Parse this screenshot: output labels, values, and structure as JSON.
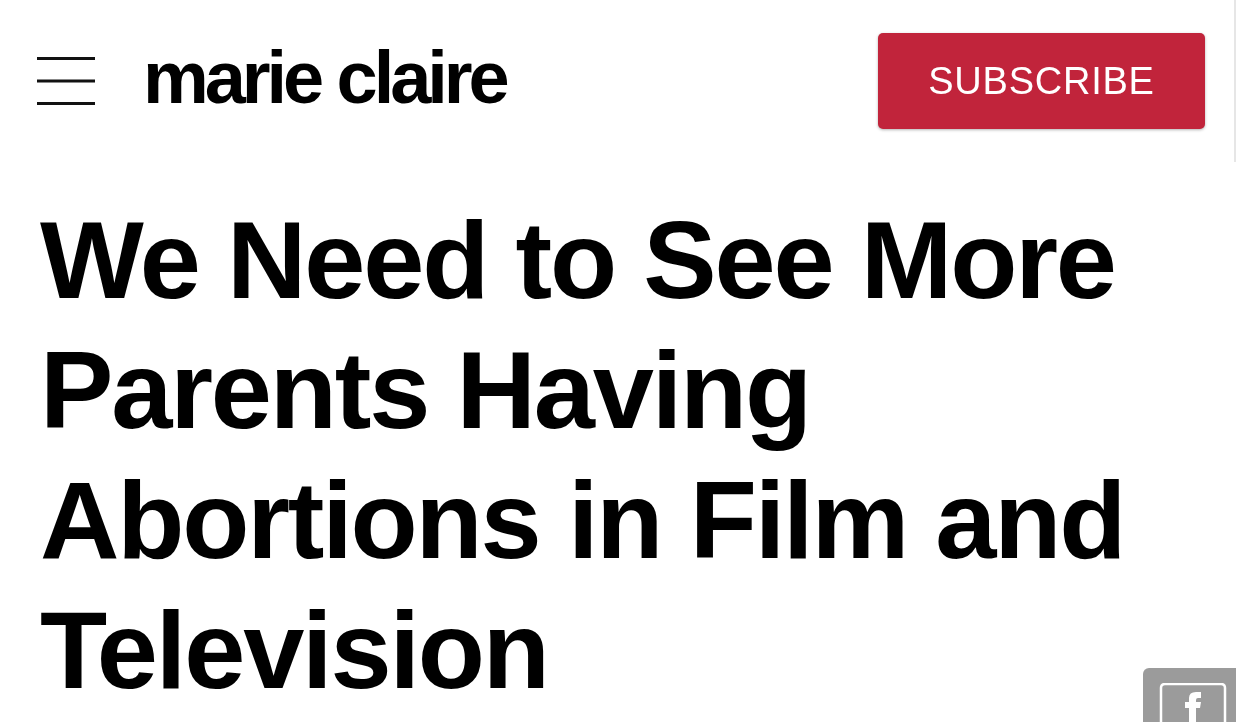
{
  "header": {
    "logo": "marie claire",
    "subscribe_button": "SUBSCRIBE"
  },
  "headline": "We Need to See More Parents Having Abortions in Film and Television"
}
